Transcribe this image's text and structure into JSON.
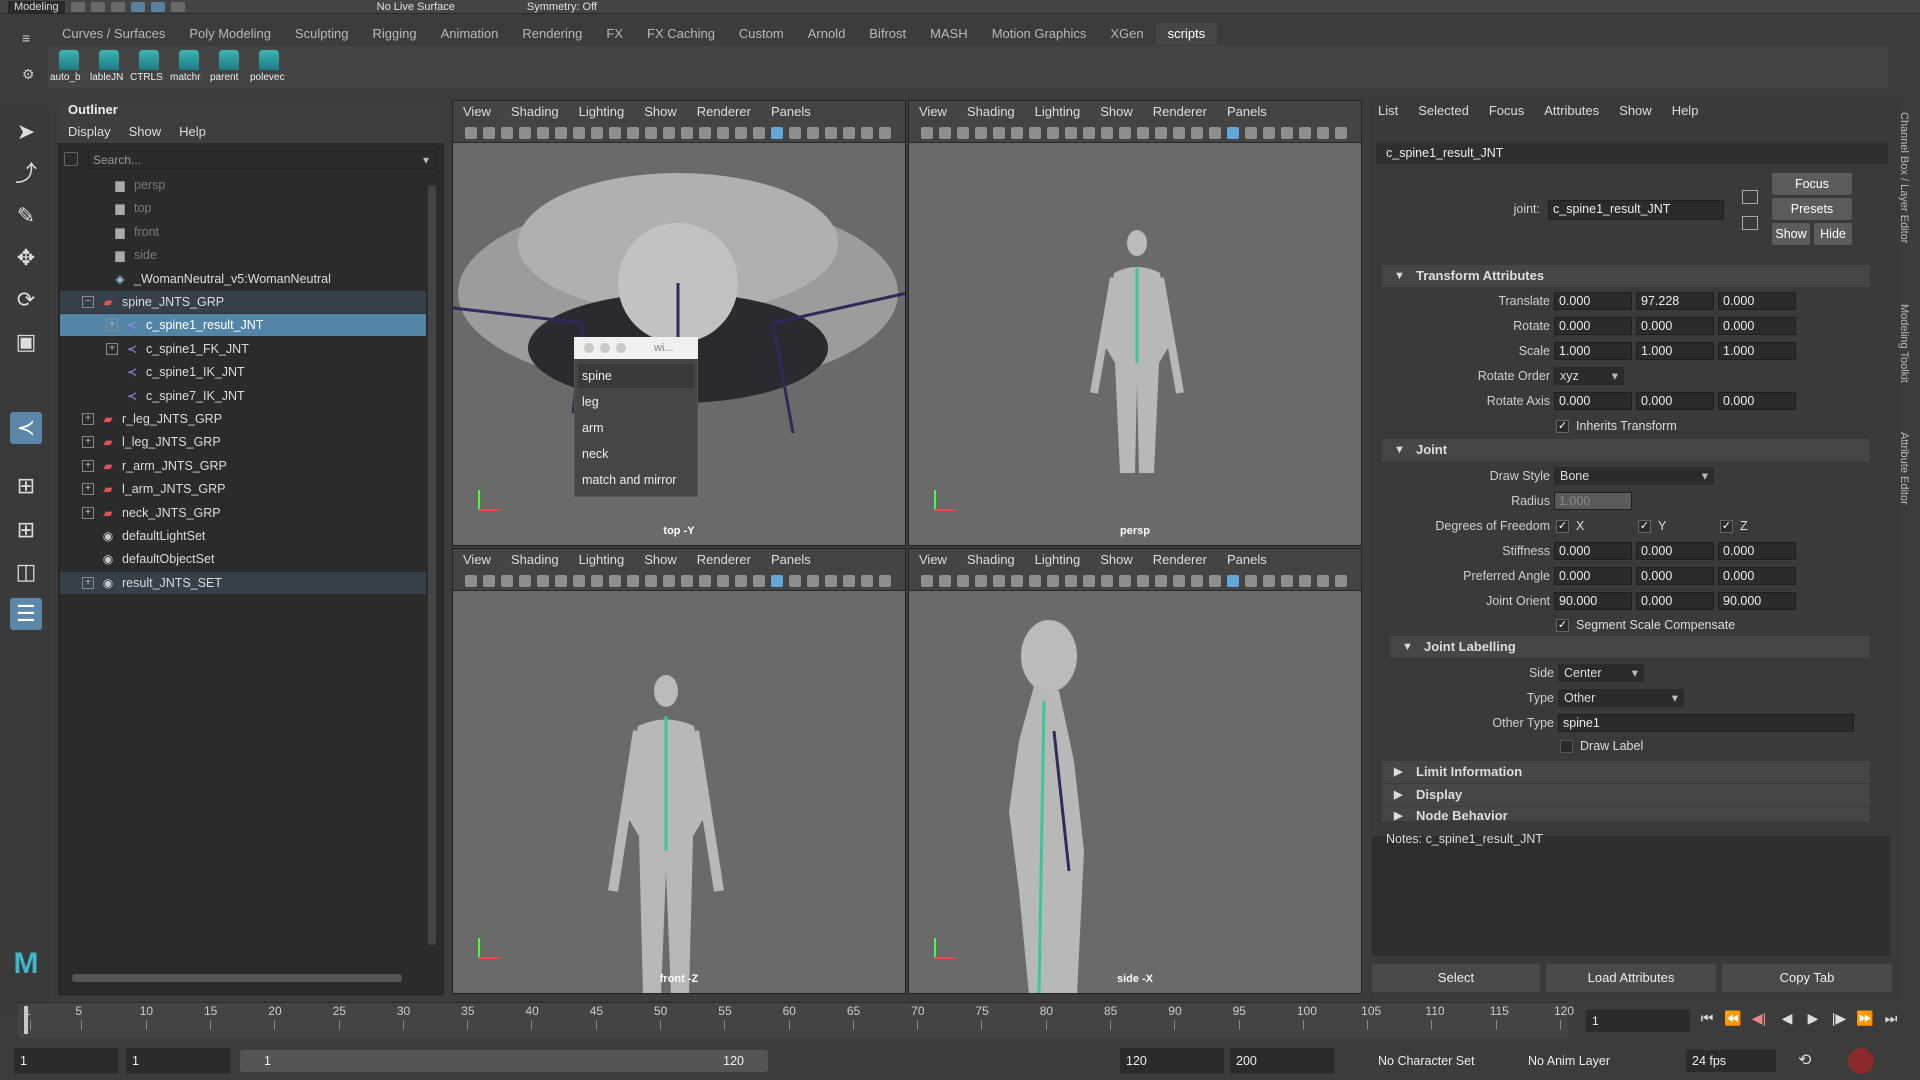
{
  "statusline": {
    "mode": "Modeling",
    "live_surface": "No Live Surface",
    "symmetry": "Symmetry: Off"
  },
  "shelf": {
    "tabs": [
      "Curves / Surfaces",
      "Poly Modeling",
      "Sculpting",
      "Rigging",
      "Animation",
      "Rendering",
      "FX",
      "FX Caching",
      "Custom",
      "Arnold",
      "Bifrost",
      "MASH",
      "Motion Graphics",
      "XGen",
      "scripts"
    ],
    "active_tab": "scripts",
    "buttons": [
      "auto_b",
      "lableJN",
      "CTRLS",
      "matchr",
      "parent",
      "polevec"
    ]
  },
  "outliner": {
    "title": "Outliner",
    "menu": [
      "Display",
      "Show",
      "Help"
    ],
    "search_placeholder": "Search...",
    "items": [
      {
        "name": "persp",
        "icon": "camera-icon",
        "dim": true
      },
      {
        "name": "top",
        "icon": "camera-icon",
        "dim": true
      },
      {
        "name": "front",
        "icon": "camera-icon",
        "dim": true
      },
      {
        "name": "side",
        "icon": "camera-icon",
        "dim": true
      },
      {
        "name": "_WomanNeutral_v5:WomanNeutral",
        "icon": "mesh-icon"
      },
      {
        "name": "spine_JNTS_GRP",
        "icon": "group-icon"
      },
      {
        "name": "c_spine1_result_JNT",
        "icon": "joint-icon"
      },
      {
        "name": "c_spine1_FK_JNT",
        "icon": "joint-icon"
      },
      {
        "name": "c_spine1_IK_JNT",
        "icon": "joint-icon"
      },
      {
        "name": "c_spine7_IK_JNT",
        "icon": "joint-icon"
      },
      {
        "name": "r_leg_JNTS_GRP",
        "icon": "group-icon"
      },
      {
        "name": "l_leg_JNTS_GRP",
        "icon": "group-icon"
      },
      {
        "name": "r_arm_JNTS_GRP",
        "icon": "group-icon"
      },
      {
        "name": "l_arm_JNTS_GRP",
        "icon": "group-icon"
      },
      {
        "name": "neck_JNTS_GRP",
        "icon": "group-icon"
      },
      {
        "name": "defaultLightSet",
        "icon": "set-icon"
      },
      {
        "name": "defaultObjectSet",
        "icon": "set-icon"
      },
      {
        "name": "result_JNTS_SET",
        "icon": "set-icon"
      }
    ]
  },
  "viewport_menu": [
    "View",
    "Shading",
    "Lighting",
    "Show",
    "Renderer",
    "Panels"
  ],
  "viewports": {
    "top": "top -Y",
    "persp": "persp",
    "front": "front -Z",
    "side": "side -X"
  },
  "marking_menu": {
    "title": "wi...",
    "items": [
      "spine",
      "leg",
      "arm",
      "neck",
      "match and mirror"
    ]
  },
  "attribute_editor": {
    "menu": [
      "List",
      "Selected",
      "Focus",
      "Attributes",
      "Show",
      "Help"
    ],
    "tab": "c_spine1_result_JNT",
    "joint_label": "joint:",
    "joint_value": "c_spine1_result_JNT",
    "buttons": {
      "focus": "Focus",
      "presets": "Presets",
      "show": "Show",
      "hide": "Hide"
    },
    "sections": {
      "transform": "Transform Attributes",
      "joint": "Joint",
      "labelling": "Joint Labelling",
      "limit": "Limit Information",
      "display": "Display",
      "node_behavior": "Node Behavior"
    },
    "transform": {
      "translate_label": "Translate",
      "translate": [
        "0.000",
        "97.228",
        "0.000"
      ],
      "rotate_label": "Rotate",
      "rotate": [
        "0.000",
        "0.000",
        "0.000"
      ],
      "scale_label": "Scale",
      "scale": [
        "1.000",
        "1.000",
        "1.000"
      ],
      "rotate_order_label": "Rotate Order",
      "rotate_order": "xyz",
      "rotate_axis_label": "Rotate Axis",
      "rotate_axis": [
        "0.000",
        "0.000",
        "0.000"
      ],
      "inherits": "Inherits Transform"
    },
    "joint": {
      "draw_style_label": "Draw Style",
      "draw_style": "Bone",
      "radius_label": "Radius",
      "radius": "1.000",
      "dof_label": "Degrees of Freedom",
      "dof": [
        "X",
        "Y",
        "Z"
      ],
      "stiffness_label": "Stiffness",
      "stiffness": [
        "0.000",
        "0.000",
        "0.000"
      ],
      "preferred_label": "Preferred Angle",
      "preferred": [
        "0.000",
        "0.000",
        "0.000"
      ],
      "orient_label": "Joint Orient",
      "orient": [
        "90.000",
        "0.000",
        "90.000"
      ],
      "segment": "Segment Scale Compensate"
    },
    "labelling": {
      "side_label": "Side",
      "side": "Center",
      "type_label": "Type",
      "type": "Other",
      "other_label": "Other Type",
      "other": "spine1",
      "draw_label": "Draw Label"
    },
    "notes_label": "Notes:  c_spine1_result_JNT",
    "bottom": [
      "Select",
      "Load Attributes",
      "Copy Tab"
    ]
  },
  "side_tabs": [
    "Channel Box / Layer Editor",
    "Modeling Toolkit",
    "Attribute Editor"
  ],
  "timeline": {
    "ticks": [
      "1",
      "5",
      "10",
      "15",
      "20",
      "25",
      "30",
      "35",
      "40",
      "45",
      "50",
      "55",
      "60",
      "65",
      "70",
      "75",
      "80",
      "85",
      "90",
      "95",
      "100",
      "105",
      "110",
      "115",
      "120"
    ],
    "current": "1"
  },
  "range": {
    "start": "1",
    "anim_start": "1",
    "slider_start": "1",
    "slider_end": "120",
    "anim_end": "120",
    "end": "200",
    "character_set": "No Character Set",
    "anim_layer": "No Anim Layer",
    "fps": "24 fps"
  }
}
